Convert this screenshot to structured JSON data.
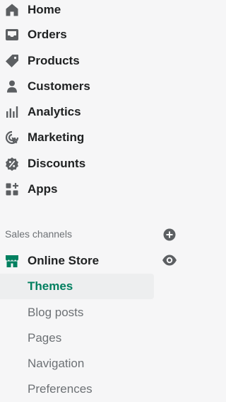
{
  "nav": {
    "items": [
      {
        "label": "Home",
        "icon": "home-icon"
      },
      {
        "label": "Orders",
        "icon": "orders-icon"
      },
      {
        "label": "Products",
        "icon": "tag-icon"
      },
      {
        "label": "Customers",
        "icon": "person-icon"
      },
      {
        "label": "Analytics",
        "icon": "bar-chart-icon"
      },
      {
        "label": "Marketing",
        "icon": "marketing-icon"
      },
      {
        "label": "Discounts",
        "icon": "discount-icon"
      },
      {
        "label": "Apps",
        "icon": "apps-icon"
      }
    ]
  },
  "sales_channels": {
    "title": "Sales channels",
    "channel": {
      "label": "Online Store",
      "icon": "store-icon"
    },
    "sub_items": [
      {
        "label": "Themes",
        "active": true
      },
      {
        "label": "Blog posts",
        "active": false
      },
      {
        "label": "Pages",
        "active": false
      },
      {
        "label": "Navigation",
        "active": false
      },
      {
        "label": "Preferences",
        "active": false
      }
    ]
  },
  "colors": {
    "active_text": "#007f5f",
    "store_icon": "#008060",
    "icon": "#5c5f62",
    "active_bg": "#edeeef"
  }
}
